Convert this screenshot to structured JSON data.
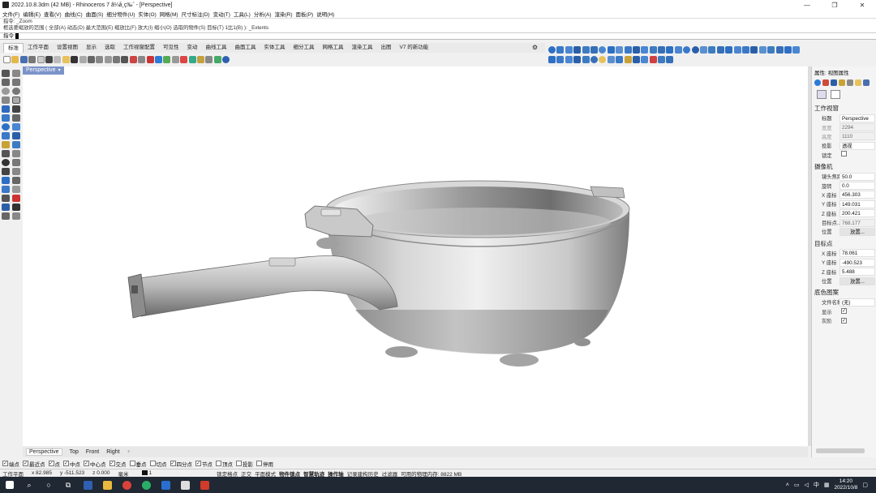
{
  "window": {
    "title": "2022.10.8.3dm (42 MB) - Rhinoceros 7 ã¼å¸ç‰ˆ - [Perspective]",
    "controls": [
      "—",
      "❐",
      "✕"
    ]
  },
  "menu": [
    "文件(F)",
    "编辑(E)",
    "查看(V)",
    "曲线(C)",
    "曲面(S)",
    "细分物件(U)",
    "实体(O)",
    "网格(M)",
    "尺寸标注(D)",
    "变动(T)",
    "工具(L)",
    "分析(A)",
    "渲染(R)",
    "面板(P)",
    "说明(H)"
  ],
  "command_history": [
    "指令: _Zoom",
    "框选要缩放的范围 ( 全部(A) 动态(D) 最大范围(E) 缩放比(F) 放大(I) 缩小(O) 选取的物件(S) 目标(T) 1比1(B) ): _Extents"
  ],
  "command_prompt": "指令:",
  "toolbar_tabs": [
    "标准",
    "工作平面",
    "设置视图",
    "显示",
    "选取",
    "工作视窗配置",
    "可见性",
    "变动",
    "曲线工具",
    "曲面工具",
    "实体工具",
    "细分工具",
    "网格工具",
    "渲染工具",
    "出图",
    "V7 的新功能"
  ],
  "active_toolbar_tab": "标准",
  "toolbar_settings_icon": "⚙",
  "viewport": {
    "label": "Perspective",
    "dropdown": "▾",
    "object": "frying-pan-model"
  },
  "viewport_tabs": [
    "Perspective",
    "Top",
    "Front",
    "Right"
  ],
  "add_viewport": "+",
  "properties": {
    "panel_title": "属性: 视图属性",
    "viewport_section": "工作视窗",
    "viewport_rows": [
      {
        "key": "标题",
        "value": "Perspective"
      },
      {
        "key": "宽度",
        "value": "2294"
      },
      {
        "key": "高度",
        "value": "1110"
      },
      {
        "key": "投影",
        "value": "透视"
      },
      {
        "key": "锁定",
        "value": ""
      }
    ],
    "camera_section": "摄像机",
    "camera_rows": [
      {
        "key": "镜头焦距",
        "value": "50.0"
      },
      {
        "key": "旋转",
        "value": "0.0"
      },
      {
        "key": "X 座标",
        "value": "456.303"
      },
      {
        "key": "Y 座标",
        "value": "149.031"
      },
      {
        "key": "Z 座标",
        "value": "200.421"
      },
      {
        "key": "目标点...",
        "value": "768.177"
      },
      {
        "key": "位置",
        "value": "放置..."
      }
    ],
    "target_section": "目标点",
    "target_rows": [
      {
        "key": "X 座标",
        "value": "78.061"
      },
      {
        "key": "Y 座标",
        "value": "-490.523"
      },
      {
        "key": "Z 座标",
        "value": "5.488"
      },
      {
        "key": "位置",
        "value": "放置..."
      }
    ],
    "background_section": "底色图案",
    "background_rows": [
      {
        "key": "文件名称",
        "value": "(无)"
      },
      {
        "key": "显示",
        "value": "✓"
      },
      {
        "key": "灰阶",
        "value": "✓"
      }
    ]
  },
  "osnaps": [
    {
      "label": "端点",
      "checked": true
    },
    {
      "label": "最近点",
      "checked": true
    },
    {
      "label": "点",
      "checked": true
    },
    {
      "label": "中点",
      "checked": true
    },
    {
      "label": "中心点",
      "checked": true
    },
    {
      "label": "交点",
      "checked": true
    },
    {
      "label": "垂点",
      "checked": false
    },
    {
      "label": "切点",
      "checked": false
    },
    {
      "label": "四分点",
      "checked": true
    },
    {
      "label": "节点",
      "checked": true
    },
    {
      "label": "顶点",
      "checked": false
    },
    {
      "label": "投影",
      "checked": false
    },
    {
      "label": "停用",
      "checked": false
    }
  ],
  "status": {
    "cplane": "工作平面",
    "x": "x 82.985",
    "y": "y -511.523",
    "z": "z 0.000",
    "units": "毫米",
    "layer": "1",
    "items_plain": [
      "锁定格点",
      "正交",
      "平面模式"
    ],
    "items_bold": [
      "物件锁点",
      "智慧轨迹",
      "操作轴"
    ],
    "items_tail": [
      "记录建构历史",
      "过滤器",
      "可用的物理内存: 8822 MB"
    ]
  },
  "taskbar": {
    "time": "14:20",
    "date": "2022/10/8",
    "ime": "中"
  },
  "colors": {
    "viewport_label_bg": "#7b93c9",
    "taskbar_bg": "#202833"
  }
}
